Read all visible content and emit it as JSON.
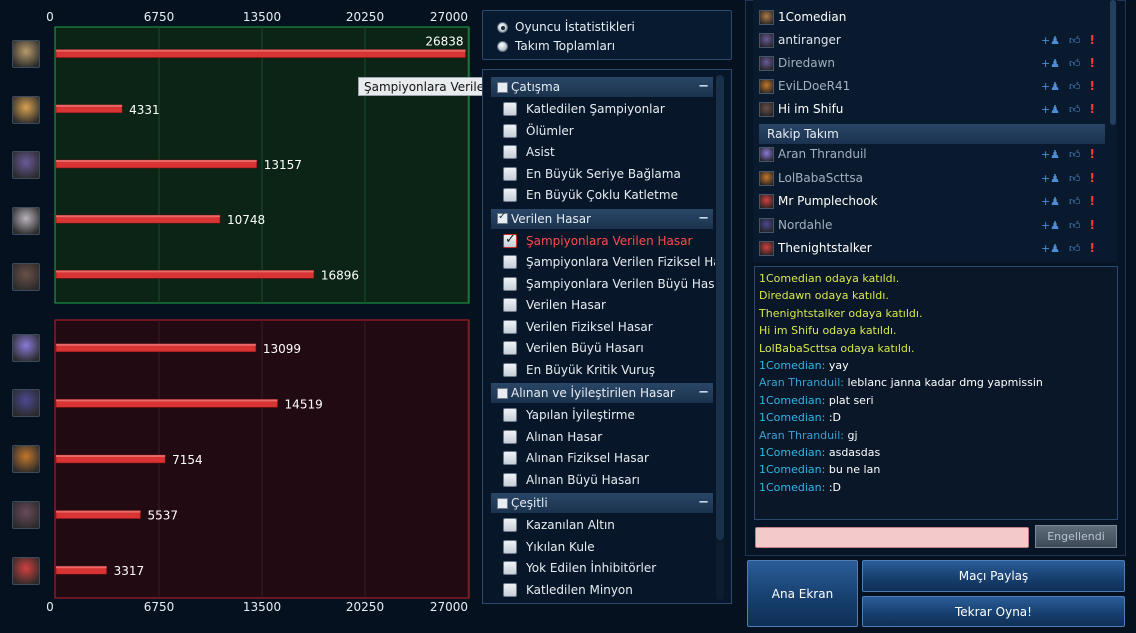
{
  "chart_data": {
    "type": "bar",
    "orientation": "horizontal",
    "axis_ticks": [
      "0",
      "6750",
      "13500",
      "20250",
      "27000"
    ],
    "xlim": [
      0,
      27000
    ],
    "grid": true,
    "teams": [
      {
        "name": "",
        "color": "#1fa64a",
        "values": [
          26838,
          4331,
          13157,
          10748,
          16896
        ]
      },
      {
        "name": "",
        "color": "#c0202a",
        "values": [
          13099,
          14519,
          7154,
          5537,
          3317
        ]
      }
    ],
    "bar_color": "#d93434"
  },
  "tooltip": "Şampiyonlara Verilen Hasar",
  "champions": [
    {
      "icon": "champion-portrait-icon",
      "color": "#b69a6c"
    },
    {
      "icon": "champion-portrait-icon",
      "color": "#d8a252"
    },
    {
      "icon": "champion-portrait-icon",
      "color": "#6a5a9a"
    },
    {
      "icon": "champion-portrait-icon",
      "color": "#b9b3bd"
    },
    {
      "icon": "champion-portrait-icon",
      "color": "#6a5048"
    },
    {
      "icon": "champion-portrait-icon",
      "color": "#8a7ad8"
    },
    {
      "icon": "champion-portrait-icon",
      "color": "#4a4890"
    },
    {
      "icon": "champion-portrait-icon",
      "color": "#c2762c"
    },
    {
      "icon": "champion-portrait-icon",
      "color": "#6a4a5a"
    },
    {
      "icon": "champion-portrait-icon",
      "color": "#d04040"
    }
  ],
  "view_mode": {
    "options": [
      "Oyuncu İstatistikleri",
      "Takım Toplamları"
    ],
    "selected": 0
  },
  "stat_groups": [
    {
      "label": "Çatışma",
      "checked": false,
      "items": [
        {
          "label": "Katledilen Şampiyonlar",
          "checked": false
        },
        {
          "label": "Ölümler",
          "checked": false
        },
        {
          "label": "Asist",
          "checked": false
        },
        {
          "label": "En Büyük Seriye Bağlama",
          "checked": false
        },
        {
          "label": "En Büyük Çoklu Katletme",
          "checked": false
        }
      ]
    },
    {
      "label": "Verilen Hasar",
      "checked": true,
      "items": [
        {
          "label": "Şampiyonlara Verilen Hasar",
          "checked": true
        },
        {
          "label": "Şampiyonlara Verilen Fiziksel Hasar",
          "checked": false
        },
        {
          "label": "Şampiyonlara Verilen Büyü Hasarı",
          "checked": false
        },
        {
          "label": "Verilen Hasar",
          "checked": false
        },
        {
          "label": "Verilen Fiziksel Hasar",
          "checked": false
        },
        {
          "label": "Verilen Büyü Hasarı",
          "checked": false
        },
        {
          "label": "En Büyük Kritik Vuruş",
          "checked": false
        }
      ]
    },
    {
      "label": "Alınan ve İyileştirilen Hasar",
      "checked": false,
      "items": [
        {
          "label": "Yapılan İyileştirme",
          "checked": false
        },
        {
          "label": "Alınan Hasar",
          "checked": false
        },
        {
          "label": "Alınan Fiziksel Hasar",
          "checked": false
        },
        {
          "label": "Alınan Büyü Hasarı",
          "checked": false
        }
      ]
    },
    {
      "label": "Çeşitli",
      "checked": false,
      "items": [
        {
          "label": "Kazanılan Altın",
          "checked": false
        },
        {
          "label": "Yıkılan Kule",
          "checked": false
        },
        {
          "label": "Yok Edilen İnhibitörler",
          "checked": false
        },
        {
          "label": "Katledilen Minyon",
          "checked": false
        }
      ]
    }
  ],
  "team_header": "Rakip Takım",
  "players": [
    {
      "name": "1Comedian",
      "style": "bright",
      "color": "#b07a4a",
      "icons": false
    },
    {
      "name": "antiranger",
      "style": "normal",
      "color": "#6a5a9a",
      "icons": true
    },
    {
      "name": "Diredawn",
      "style": "dim",
      "color": "#6a5a9a",
      "icons": true
    },
    {
      "name": "EviLDoeR41",
      "style": "dim",
      "color": "#c2762c",
      "icons": true
    },
    {
      "name": "Hi im Shifu",
      "style": "bright",
      "color": "#6a5048",
      "icons": true
    },
    {
      "name": "Aran Thranduil",
      "style": "dim",
      "color": "#8a7ad8",
      "icons": true
    },
    {
      "name": "LolBabaScttsa",
      "style": "dim",
      "color": "#c2762c",
      "icons": true
    },
    {
      "name": "Mr Pumplechook",
      "style": "bright",
      "color": "#d04040",
      "icons": true
    },
    {
      "name": "Nordahle",
      "style": "dim",
      "color": "#4a4890",
      "icons": true
    },
    {
      "name": "Thenightstalker",
      "style": "bright",
      "color": "#d04040",
      "icons": true
    }
  ],
  "chat": [
    {
      "type": "sys",
      "text": "1Comedian odaya katıldı."
    },
    {
      "type": "sys",
      "text": "Diredawn odaya katıldı."
    },
    {
      "type": "sys",
      "text": "Thenightstalker odaya katıldı."
    },
    {
      "type": "sys",
      "text": "Hi im Shifu odaya katıldı."
    },
    {
      "type": "sys",
      "text": "LolBabaScttsa odaya katıldı."
    },
    {
      "type": "msg",
      "name": "1Comedian:",
      "text": "yay",
      "team": "ally"
    },
    {
      "type": "msg",
      "name": "Aran Thranduil:",
      "text": "leblanc janna kadar dmg yapmissin",
      "team": "enemy"
    },
    {
      "type": "msg",
      "name": "1Comedian:",
      "text": "plat seri",
      "team": "ally"
    },
    {
      "type": "msg",
      "name": "1Comedian:",
      "text": ":D",
      "team": "ally"
    },
    {
      "type": "msg",
      "name": "Aran Thranduil:",
      "text": "gj",
      "team": "enemy"
    },
    {
      "type": "msg",
      "name": "1Comedian:",
      "text": "asdasdas",
      "team": "ally"
    },
    {
      "type": "msg",
      "name": "1Comedian:",
      "text": "bu ne lan",
      "team": "ally"
    },
    {
      "type": "msg",
      "name": "1Comedian:",
      "text": ":D",
      "team": "ally"
    }
  ],
  "chat_input": {
    "value": "",
    "placeholder": ""
  },
  "buttons": {
    "mute": "Engellendi",
    "home": "Ana Ekran",
    "share": "Maçı Paylaş",
    "replay": "Tekrar Oyna!"
  }
}
